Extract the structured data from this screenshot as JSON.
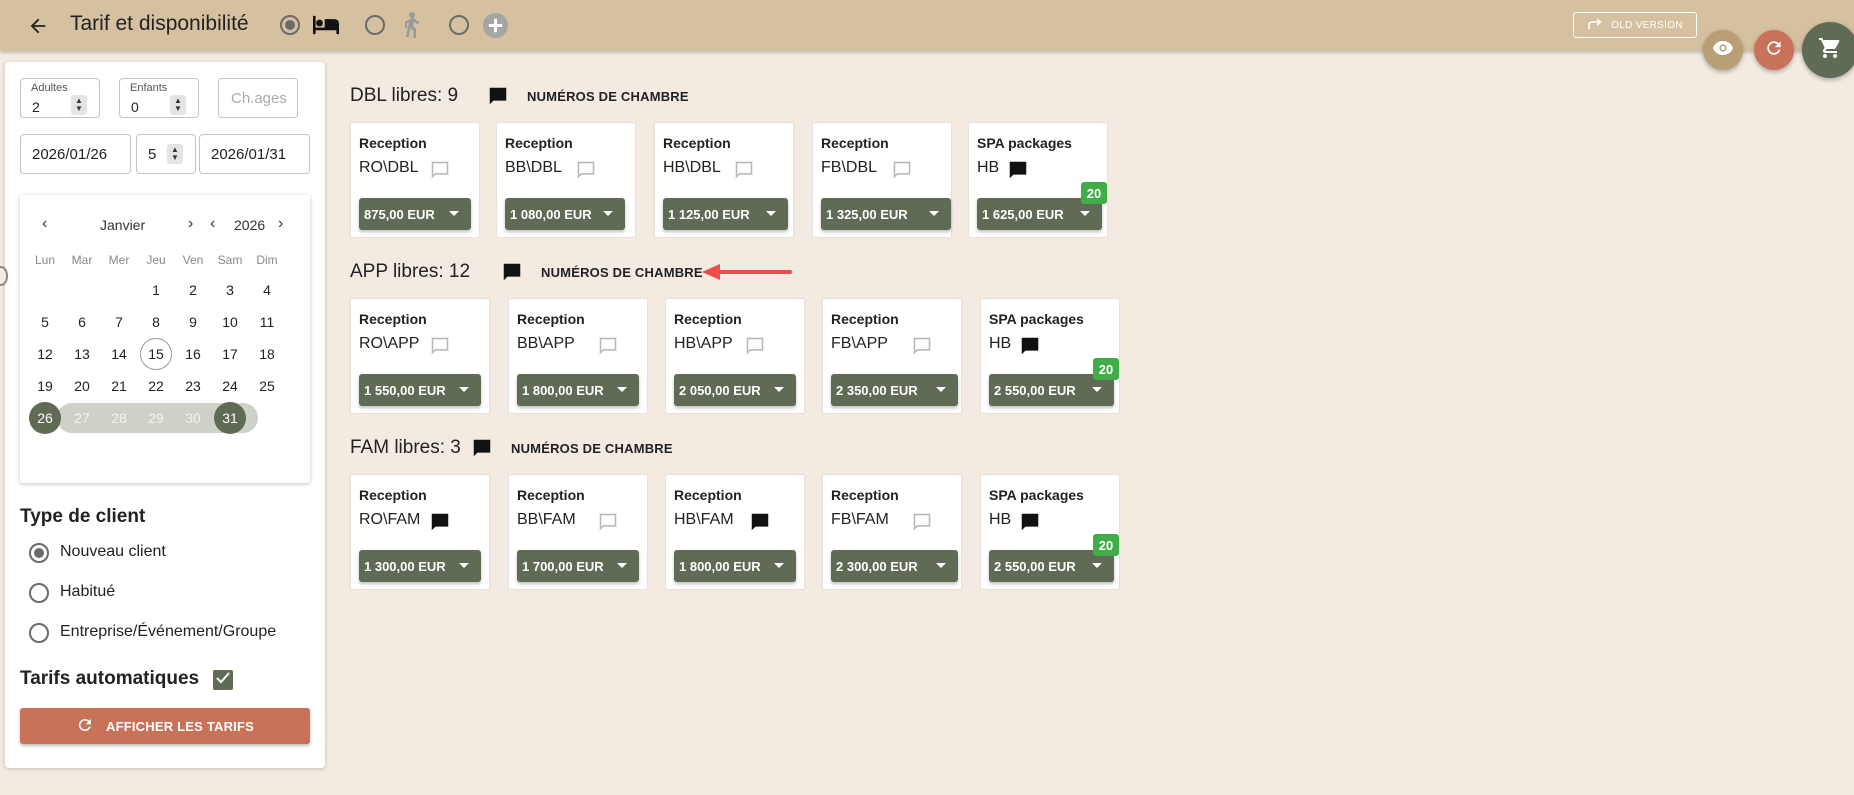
{
  "header": {
    "title": "Tarif et disponibilité",
    "old_version_label": "OLD VERSION",
    "mode_options": [
      {
        "icon": "bed-icon",
        "selected": true
      },
      {
        "icon": "walking-person-icon",
        "selected": false
      },
      {
        "icon": "plus-circle-icon",
        "selected": false
      }
    ]
  },
  "search": {
    "adults_label": "Adultes",
    "adults_value": "2",
    "children_label": "Enfants",
    "children_value": "0",
    "ages_placeholder": "Ch.ages",
    "date_from": "2026/01/26",
    "nights": "5",
    "date_to": "2026/01/31"
  },
  "calendar": {
    "month": "Janvier",
    "year": "2026",
    "weekdays": [
      "Lun",
      "Mar",
      "Mer",
      "Jeu",
      "Ven",
      "Sam",
      "Dim"
    ],
    "weeks": [
      [
        "",
        "",
        "",
        "1",
        "2",
        "3",
        "4"
      ],
      [
        "5",
        "6",
        "7",
        "8",
        "9",
        "10",
        "11"
      ],
      [
        "12",
        "13",
        "14",
        "15",
        "16",
        "17",
        "18"
      ],
      [
        "19",
        "20",
        "21",
        "22",
        "23",
        "24",
        "25"
      ],
      [
        "26",
        "27",
        "28",
        "29",
        "30",
        "31",
        ""
      ]
    ],
    "today": "15",
    "range_start": "26",
    "range_end": "31"
  },
  "client_type": {
    "title": "Type de client",
    "options": [
      "Nouveau client",
      "Habitué",
      "Entreprise/Événement/Groupe"
    ],
    "selected_index": 0
  },
  "auto_rates": {
    "label": "Tarifs automatiques",
    "checked": true
  },
  "show_rates_label": "AFFICHER LES TARIFS",
  "rooms_label": "NUMÉROS DE CHAMBRE",
  "rooms": [
    {
      "title": "DBL libres: 9",
      "cards": [
        {
          "category": "Reception",
          "code": "RO\\DBL",
          "note_filled": false,
          "price": "875,00 EUR"
        },
        {
          "category": "Reception",
          "code": "BB\\DBL",
          "note_filled": false,
          "price": "1 080,00 EUR"
        },
        {
          "category": "Reception",
          "code": "HB\\DBL",
          "note_filled": false,
          "price": "1 125,00 EUR"
        },
        {
          "category": "Reception",
          "code": "FB\\DBL",
          "note_filled": false,
          "price": "1 325,00 EUR"
        },
        {
          "category": "SPA packages",
          "code": "HB",
          "note_filled": true,
          "price": "1 625,00 EUR",
          "badge": "20"
        }
      ]
    },
    {
      "title": "APP libres: 12",
      "cards": [
        {
          "category": "Reception",
          "code": "RO\\APP",
          "note_filled": false,
          "price": "1 550,00 EUR"
        },
        {
          "category": "Reception",
          "code": "BB\\APP",
          "note_filled": false,
          "price": "1 800,00 EUR"
        },
        {
          "category": "Reception",
          "code": "HB\\APP",
          "note_filled": false,
          "price": "2 050,00 EUR"
        },
        {
          "category": "Reception",
          "code": "FB\\APP",
          "note_filled": false,
          "price": "2 350,00 EUR"
        },
        {
          "category": "SPA packages",
          "code": "HB",
          "note_filled": true,
          "price": "2 550,00 EUR",
          "badge": "20"
        }
      ]
    },
    {
      "title": "FAM libres: 3",
      "cards": [
        {
          "category": "Reception",
          "code": "RO\\FAM",
          "note_filled": true,
          "price": "1 300,00 EUR"
        },
        {
          "category": "Reception",
          "code": "BB\\FAM",
          "note_filled": false,
          "price": "1 700,00 EUR"
        },
        {
          "category": "Reception",
          "code": "HB\\FAM",
          "note_filled": true,
          "price": "1 800,00 EUR"
        },
        {
          "category": "Reception",
          "code": "FB\\FAM",
          "note_filled": false,
          "price": "2 300,00 EUR"
        },
        {
          "category": "SPA packages",
          "code": "HB",
          "note_filled": true,
          "price": "2 550,00 EUR",
          "badge": "20"
        }
      ]
    }
  ],
  "colors": {
    "topbar": "#d5c1a0",
    "background": "#f3ebe2",
    "primary_green": "#5f6b55",
    "accent_terracotta": "#c9725a",
    "badge_green": "#3fae49",
    "annotation_arrow": "#ee4b4b"
  }
}
